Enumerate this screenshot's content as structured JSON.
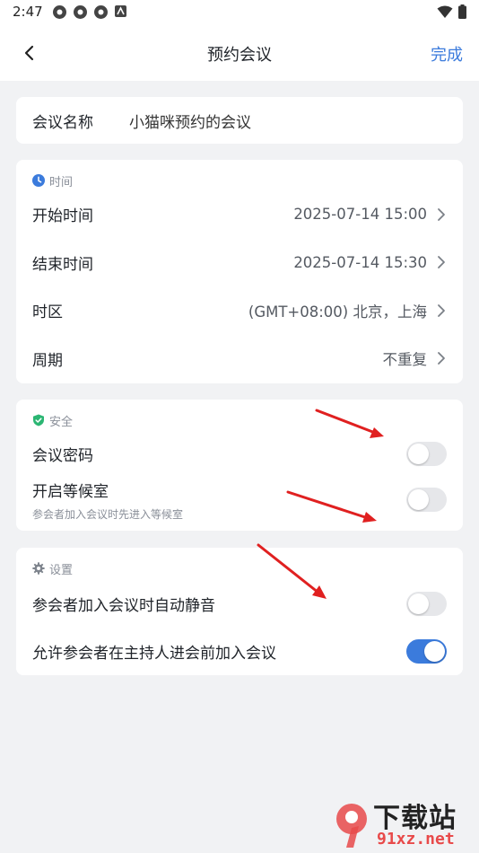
{
  "status_bar": {
    "time": "2:47",
    "wifi_icon": "wifi-icon",
    "battery_icon": "battery-icon"
  },
  "header": {
    "title": "预约会议",
    "done_label": "完成",
    "back_icon": "chevron-left-icon"
  },
  "meeting_name": {
    "label": "会议名称",
    "value": "小猫咪预约的会议"
  },
  "time_section": {
    "title": "时间",
    "icon": "clock-icon",
    "rows": [
      {
        "label": "开始时间",
        "value": "2025-07-14 15:00"
      },
      {
        "label": "结束时间",
        "value": "2025-07-14 15:30"
      },
      {
        "label": "时区",
        "value": "(GMT+08:00) 北京，上海"
      },
      {
        "label": "周期",
        "value": "不重复"
      }
    ]
  },
  "security_section": {
    "title": "安全",
    "icon": "shield-check-icon",
    "rows": [
      {
        "label": "会议密码",
        "on": false
      },
      {
        "label": "开启等候室",
        "sub": "参会者加入会议时先进入等候室",
        "on": false
      }
    ]
  },
  "settings_section": {
    "title": "设置",
    "icon": "gear-icon",
    "rows": [
      {
        "label": "参会者加入会议时自动静音",
        "on": false
      },
      {
        "label": "允许参会者在主持人进会前加入会议",
        "on": true
      }
    ]
  },
  "watermark": {
    "text": "下载站",
    "url_text": "91xz.net"
  },
  "colors": {
    "accent": "#3b7bdc",
    "background": "#f1f2f4",
    "arrow": "#e02020",
    "shield": "#2bb673"
  }
}
